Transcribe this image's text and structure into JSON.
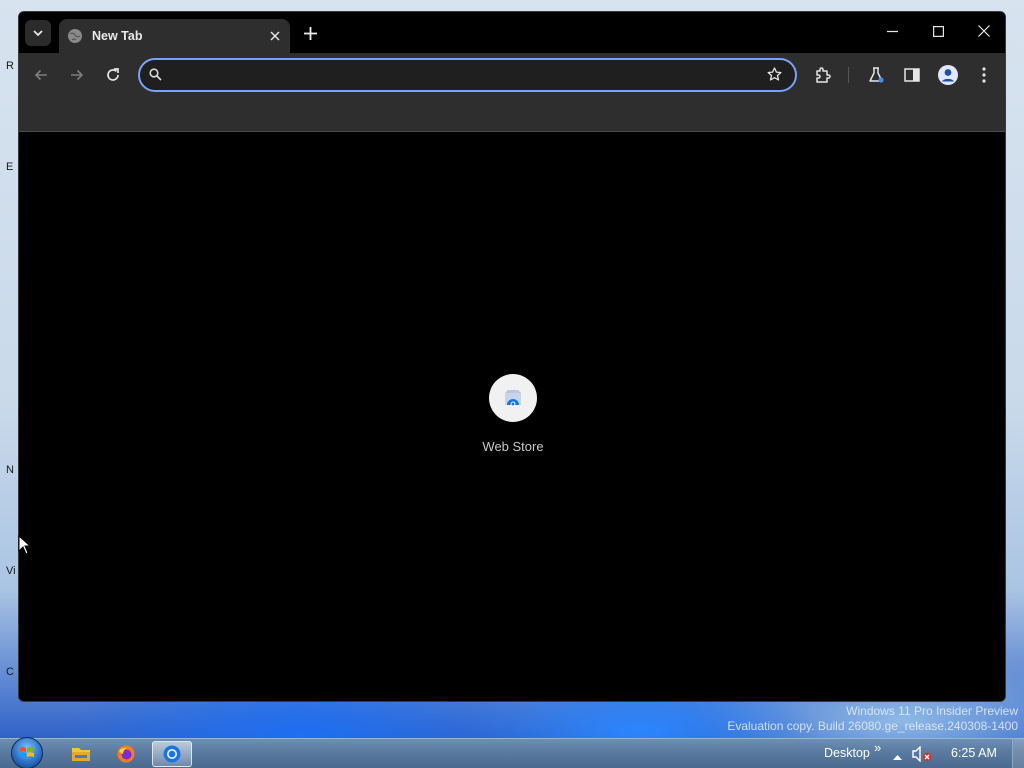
{
  "browser": {
    "tab": {
      "title": "New Tab"
    },
    "omnibox": {
      "value": "",
      "placeholder": ""
    },
    "shortcut": {
      "label": "Web Store"
    },
    "accent": "#7aa2f7"
  },
  "desktop": {
    "watermark_line1": "Windows 11 Pro Insider Preview",
    "watermark_line2": "Evaluation copy. Build 26080.ge_release.240308-1400",
    "icon_stubs": [
      "R",
      "E",
      "N",
      "Vi",
      "C"
    ]
  },
  "taskbar": {
    "apps": [
      "file-explorer-icon",
      "firefox-icon",
      "chrome-icon"
    ],
    "toolbar_label": "Desktop",
    "overflow": "»",
    "clock": "6:25 AM"
  }
}
